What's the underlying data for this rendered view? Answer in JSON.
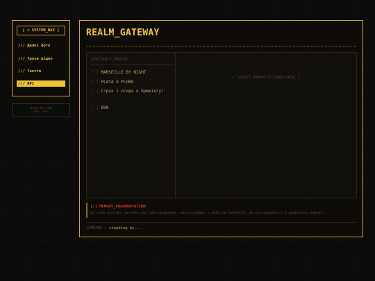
{
  "nav": {
    "title": "[ < SYSTEM_NAV ]",
    "items": [
      {
        "label": "/// Деякі фото"
      },
      {
        "label": "/// Трохи відео"
      },
      {
        "label": "/// Тексти"
      },
      {
        "label": "/// RPI",
        "active": true
      }
    ]
  },
  "sysinfo": {
    "line1": "SECURE_RPI_LINK",
    "line2": "EXEC: 2024"
  },
  "main": {
    "title": "REALM_GATEWAY",
    "realms_header": "AVAILABLE_REALMS:",
    "realms": [
      {
        "marker": "[ ]",
        "name": "MARSEILLE BY NIGHT"
      },
      {
        "marker": "[ ]",
        "name": "PLATA O PLOMO"
      },
      {
        "marker": "[ ]",
        "name": "Страх і огида в Брюкінгу!"
      },
      {
        "marker": "[ ]",
        "name": "BSN"
      }
    ],
    "empty_state": "[ SELECT REALM TO VIEW DATA ]",
    "memory": {
      "title": "[!] MEMORY_FRAGMENTATION:",
      "text": "Ця зона охоплює частини від пригодницьких, навігаційних і вибухів кампаній, що розглядаються у цифровому вимірі."
    },
    "command": {
      "prompt": "COMMAND >",
      "status": "standing by..."
    }
  },
  "colors": {
    "accent": "#f2c43a",
    "border": "#d4a52a",
    "alert": "#d03a2a",
    "background": "#0b0b09"
  }
}
